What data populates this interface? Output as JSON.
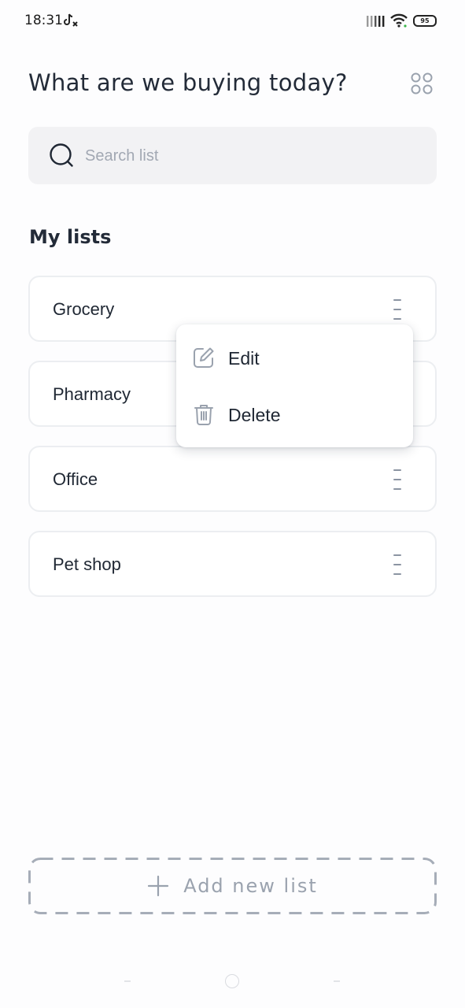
{
  "status_bar": {
    "time": "18:31",
    "battery": "95",
    "icons": [
      "tiktok-icon",
      "signal-icon",
      "wifi-icon",
      "battery-icon"
    ]
  },
  "header": {
    "title": "What are we buying today?",
    "grid_icon": "grid-view-icon"
  },
  "search": {
    "placeholder": "Search list",
    "value": ""
  },
  "section": {
    "title": "My lists"
  },
  "lists": [
    {
      "label": "Grocery"
    },
    {
      "label": "Pharmacy"
    },
    {
      "label": "Office"
    },
    {
      "label": "Pet shop"
    }
  ],
  "context_menu": {
    "items": [
      {
        "label": "Edit",
        "icon": "edit-icon"
      },
      {
        "label": "Delete",
        "icon": "trash-icon"
      }
    ]
  },
  "add_button": {
    "label": "Add new list"
  },
  "colors": {
    "text": "#1f2733",
    "muted": "#9aa2ae",
    "border": "#eceef1",
    "search_bg": "#f2f2f4",
    "dashed_border": "#a6adb8"
  }
}
